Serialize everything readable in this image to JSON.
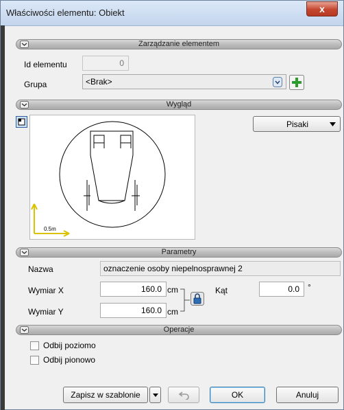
{
  "window": {
    "title": "Właściwości elementu: Obiekt",
    "close_symbol": "x"
  },
  "sections": {
    "management": "Zarządzanie elementem",
    "appearance": "Wygląd",
    "parameters": "Parametry",
    "operations": "Operacje"
  },
  "management": {
    "id_label": "Id elementu",
    "id_value": "0",
    "group_label": "Grupa",
    "group_value": "<Brak>"
  },
  "appearance": {
    "pens_button": "Pisaki",
    "scale_label": "0.5m"
  },
  "parameters": {
    "name_label": "Nazwa",
    "name_value": "oznaczenie osoby niepelnosprawnej 2",
    "dim_x_label": "Wymiar X",
    "dim_x_value": "160.0",
    "dim_x_unit": "cm",
    "dim_y_label": "Wymiar Y",
    "dim_y_value": "160.0",
    "dim_y_unit": "cm",
    "angle_label": "Kąt",
    "angle_value": "0.0",
    "angle_unit": "°"
  },
  "operations": {
    "mirror_horizontal_label": "Odbij poziomo",
    "mirror_horizontal_checked": false,
    "mirror_vertical_label": "Odbij pionowo",
    "mirror_vertical_checked": false
  },
  "footer": {
    "save_template_label": "Zapisz w szablonie",
    "ok_label": "OK",
    "cancel_label": "Anuluj"
  },
  "colors": {
    "accent_green": "#2e9b2e",
    "lock_blue": "#2c6db5",
    "axis_yellow": "#d9c200"
  }
}
